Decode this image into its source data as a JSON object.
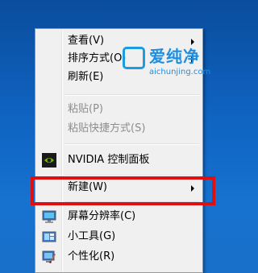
{
  "menu": {
    "items": [
      {
        "label": "查看(V)",
        "submenu": true
      },
      {
        "label": "排序方式(O)",
        "submenu": true
      },
      {
        "label": "刷新(E)"
      },
      {
        "label": "粘贴(P)",
        "disabled": true
      },
      {
        "label": "粘贴快捷方式(S)",
        "disabled": true
      },
      {
        "label": "NVIDIA 控制面板",
        "icon": "nvidia-icon"
      },
      {
        "label": "新建(W)",
        "submenu": true
      },
      {
        "label": "屏幕分辨率(C)",
        "icon": "screen-resolution-icon",
        "highlighted": true
      },
      {
        "label": "小工具(G)",
        "icon": "gadgets-icon"
      },
      {
        "label": "个性化(R)",
        "icon": "personalize-icon"
      }
    ]
  },
  "watermark": {
    "title": "爱纯净",
    "url": "aichunjing.com"
  },
  "colors": {
    "desktop": "#0f62c0",
    "menu_bg": "#f0f0f0",
    "highlight_border": "#e01010",
    "watermark": "#1e8fe0"
  }
}
